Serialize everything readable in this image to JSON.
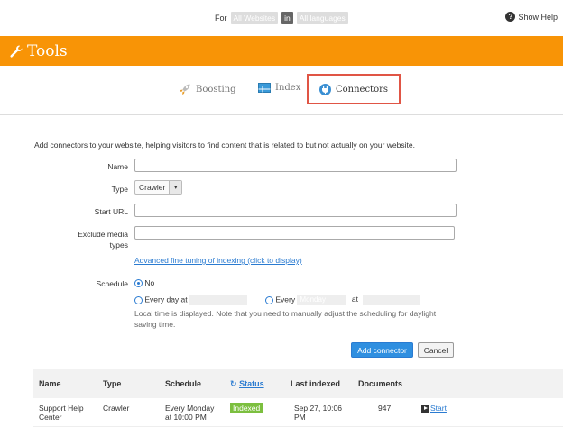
{
  "topbar": {
    "for_label": "For",
    "website_chip": "All Websites",
    "in_label": "in",
    "language_chip": "All languages",
    "help_label": "Show Help",
    "help_icon": "question-icon"
  },
  "header": {
    "title": "Tools",
    "icon": "wrench-icon"
  },
  "tabs": [
    {
      "label": "Boosting",
      "icon": "rocket-icon"
    },
    {
      "label": "Index",
      "icon": "table-icon"
    },
    {
      "label": "Connectors",
      "icon": "plug-icon"
    }
  ],
  "form": {
    "intro": "Add connectors to your website, helping visitors to find content that is related to but not actually on your website.",
    "name_label": "Name",
    "type_label": "Type",
    "type_value": "Crawler",
    "start_url_label": "Start URL",
    "exclude_label_1": "Exclude media",
    "exclude_label_2": "types",
    "advanced_link": "Advanced fine tuning of indexing (click to display)",
    "schedule_label": "Schedule",
    "opt_no": "No",
    "opt_every_day": "Every day at",
    "opt_every": "Every",
    "every_value": "Monday",
    "at_label": "at",
    "note": "Local time is displayed. Note that you need to manually adjust the scheduling for daylight saving time.",
    "add_button": "Add connector",
    "cancel_button": "Cancel"
  },
  "table": {
    "headers": {
      "name": "Name",
      "type": "Type",
      "schedule": "Schedule",
      "status": "Status",
      "last_indexed": "Last indexed",
      "documents": "Documents"
    },
    "rows": [
      {
        "name_1": "Support Help",
        "name_2": "Center",
        "type": "Crawler",
        "schedule_1": "Every Monday",
        "schedule_2": "at 10:00 PM",
        "status": "Indexed",
        "last_1": "Sep 27, 10:06",
        "last_2": "PM",
        "documents": "947",
        "action": "Start"
      }
    ]
  },
  "colors": {
    "accent": "#f89406",
    "link": "#2a7bd1",
    "indexed": "#7cbf3f",
    "highlight": "#e05545"
  }
}
